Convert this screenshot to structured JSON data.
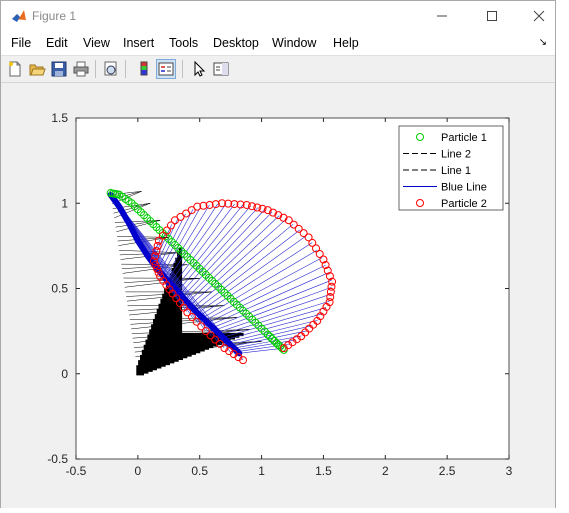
{
  "window": {
    "title": "Figure 1",
    "minimize_icon": "minimize-icon",
    "maximize_icon": "maximize-icon",
    "close_icon": "close-icon"
  },
  "menu": [
    "File",
    "Edit",
    "View",
    "Insert",
    "Tools",
    "Desktop",
    "Window",
    "Help"
  ],
  "toolbar_icons": [
    "new-figure-icon",
    "open-file-icon",
    "save-icon",
    "print-icon",
    "print-preview-icon",
    "colorbar-icon",
    "legend-icon",
    "pointer-icon",
    "property-editor-icon"
  ],
  "chart_data": {
    "type": "line",
    "xlim": [
      -0.5,
      3.0
    ],
    "ylim": [
      -0.5,
      1.5
    ],
    "xticks": [
      "-0.5",
      "0",
      "0.5",
      "1",
      "1.5",
      "2",
      "2.5",
      "3"
    ],
    "yticks": [
      "-0.5",
      "0",
      "0.5",
      "1",
      "1.5"
    ],
    "xticks_values": [
      -0.5,
      0,
      0.5,
      1,
      1.5,
      2,
      2.5,
      3
    ],
    "yticks_values": [
      -0.5,
      0,
      0.5,
      1,
      1.5
    ],
    "legend_position": "top-right",
    "series": [
      {
        "name": "Particle 1",
        "style": "circle markers",
        "color": "#00cc00",
        "x": [
          -0.22,
          -0.15,
          -0.05,
          0.05,
          0.15,
          0.25,
          0.35,
          0.45,
          0.55,
          0.65,
          0.75,
          0.85,
          0.95,
          1.05,
          1.12,
          1.18
        ],
        "y": [
          1.06,
          1.05,
          1.0,
          0.93,
          0.86,
          0.79,
          0.72,
          0.65,
          0.58,
          0.51,
          0.44,
          0.37,
          0.3,
          0.23,
          0.18,
          0.14
        ]
      },
      {
        "name": "Line 2",
        "style": "dashed",
        "color": "#000000",
        "x": [],
        "y": []
      },
      {
        "name": "Line 1",
        "style": "dashed",
        "color": "#000000",
        "x": [],
        "y": []
      },
      {
        "name": "Blue Line",
        "style": "solid",
        "color": "#0000cc",
        "x": [
          -0.22,
          -0.15,
          -0.07,
          0.0,
          0.08,
          0.15,
          0.25,
          0.35,
          0.45,
          0.55,
          0.65,
          0.75,
          0.82
        ],
        "y": [
          1.05,
          0.98,
          0.88,
          0.78,
          0.69,
          0.62,
          0.54,
          0.46,
          0.38,
          0.31,
          0.24,
          0.17,
          0.12
        ]
      },
      {
        "name": "Particle 2",
        "style": "circle markers",
        "color": "#ff0000",
        "x": [
          0.85,
          0.7,
          0.55,
          0.4,
          0.28,
          0.18,
          0.13,
          0.17,
          0.3,
          0.48,
          0.68,
          0.88,
          1.05,
          1.22,
          1.38,
          1.5,
          1.57,
          1.55,
          1.45,
          1.32,
          1.18
        ],
        "y": [
          0.08,
          0.15,
          0.25,
          0.36,
          0.47,
          0.57,
          0.66,
          0.78,
          0.9,
          0.98,
          1.0,
          0.99,
          0.96,
          0.9,
          0.8,
          0.67,
          0.54,
          0.42,
          0.31,
          0.22,
          0.15
        ]
      }
    ]
  }
}
